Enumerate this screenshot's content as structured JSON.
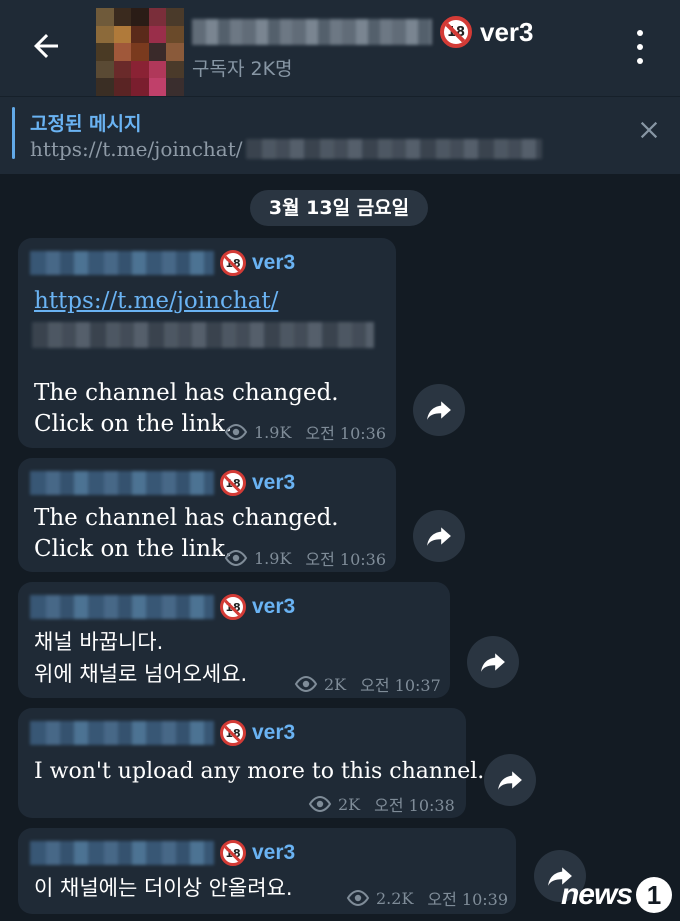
{
  "header": {
    "channel_suffix": "ver3",
    "subscribers": "구독자 2K명",
    "back_icon": "arrow-left-icon",
    "menu_icon": "more-vertical-icon"
  },
  "pinned": {
    "title": "고정된 메시지",
    "link_prefix": "https://t.me/joinchat/",
    "close_icon": "close-icon"
  },
  "date_label": "3월 13일 금요일",
  "messages": [
    {
      "sender_suffix": "ver3",
      "link": "https://t.me/joinchat/",
      "text1": "The channel has changed.",
      "text2": "Click on the link.",
      "views": "1.9K",
      "time": "오전 10:36"
    },
    {
      "sender_suffix": "ver3",
      "text1": "The channel has changed.",
      "text2": "Click on the link.",
      "views": "1.9K",
      "time": "오전 10:36"
    },
    {
      "sender_suffix": "ver3",
      "text1": "채널 바꿉니다.",
      "text2": "위에 채널로 넘어오세요.",
      "views": "2K",
      "time": "오전 10:37"
    },
    {
      "sender_suffix": "ver3",
      "text1": "I won't upload any more to this channel.",
      "views": "2K",
      "time": "오전 10:38"
    },
    {
      "sender_suffix": "ver3",
      "text1": "이 채널에는 더이상 안올려요.",
      "views": "2.2K",
      "time": "오전 10:39"
    }
  ],
  "watermark": {
    "text": "news",
    "mark": "1"
  },
  "colors": {
    "background": "#131b23",
    "header": "#1f2a36",
    "accent": "#6ab3f3",
    "bubble": "#1f2a36"
  }
}
